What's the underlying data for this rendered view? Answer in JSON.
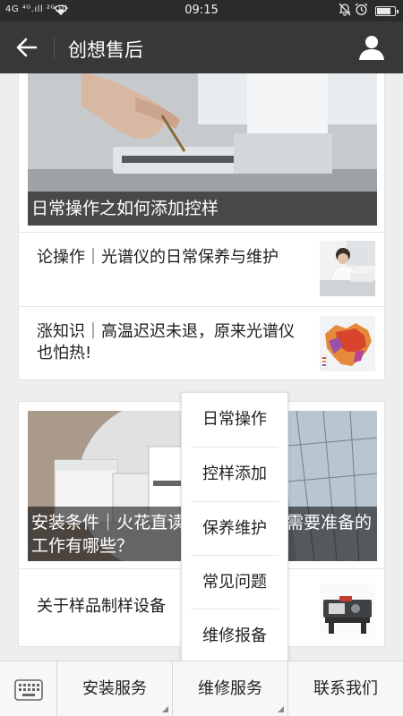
{
  "status_bar": {
    "network": "4G ⁴ᴳ.ıll ²ᴳ.ıll",
    "time": "09:15",
    "battery_level": 0.8
  },
  "nav": {
    "title": "创想售后"
  },
  "cards": [
    {
      "hero_caption": "日常操作之如何添加控样",
      "articles": [
        {
          "title": "论操作｜光谱仪的日常保养与维护"
        },
        {
          "title": "涨知识｜高温迟迟未退，原来光谱仪也怕热!"
        }
      ]
    },
    {
      "hero_caption": "安装条件｜火花直读光谱仪安装前需要准备的工作有哪些？",
      "articles": [
        {
          "title": "关于样品制样设备"
        }
      ]
    }
  ],
  "popup_menu": {
    "items": [
      "日常操作",
      "控样添加",
      "保养维护",
      "常见问题",
      "维修报备"
    ]
  },
  "bottom_menu": {
    "tabs": [
      "安装服务",
      "维修服务",
      "联系我们"
    ]
  },
  "icons": {
    "back": "back-arrow-icon",
    "profile": "user-icon",
    "keyboard": "keyboard-icon",
    "wifi": "wifi-icon",
    "bell": "bell-off-icon",
    "alarm": "alarm-clock-icon"
  },
  "colors": {
    "status_bar": "#2b2b2b",
    "nav_bar": "#383838",
    "background": "#eeeeee",
    "caption_overlay": "rgba(0,0,0,0.55)"
  }
}
